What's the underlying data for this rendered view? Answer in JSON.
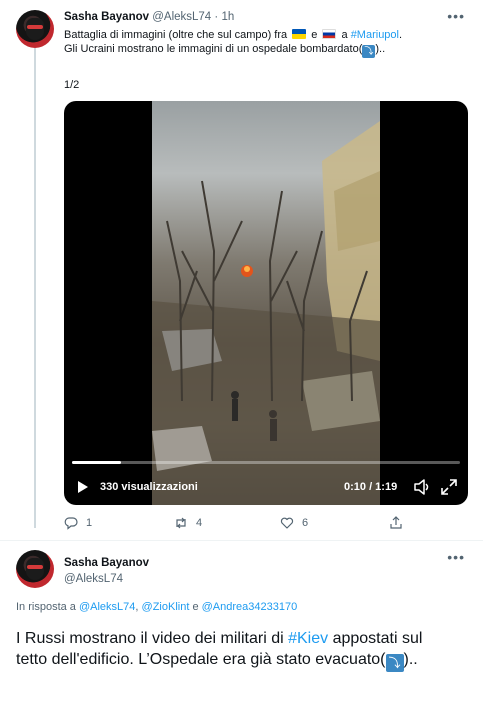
{
  "tweet1": {
    "author_name": "Sasha Bayanov",
    "author_handle": "@AleksL74",
    "separator": "·",
    "time": "1h",
    "more_icon": "more-horizontal-icon",
    "line1_prefix": "Battaglia di immagini (oltre che sul campo) fra ",
    "line1_and": " e ",
    "line1_a": " a ",
    "hashtag": "#Mariupol",
    "line1_end": ".",
    "line2": "Gli Ucraini mostrano le immagini di un ospedale bombardato(",
    "line2_end": ")..",
    "counter": "1/2",
    "video": {
      "views": "330 visualizzazioni",
      "time": "0:10 / 1:19",
      "progress": 0.127
    },
    "actions": {
      "reply_count": "1",
      "retweet_count": "4",
      "like_count": "6"
    }
  },
  "tweet2": {
    "author_name": "Sasha Bayanov",
    "author_handle": "@AleksL74",
    "reply_prefix": "In risposta a ",
    "reply_user1": "@AleksL74",
    "reply_sep1": ", ",
    "reply_user2": "@ZioKlint",
    "reply_sep2": " e ",
    "reply_user3": "@Andrea34233170",
    "text_prefix": "I Russi mostrano il video dei militari di ",
    "hashtag": "#Kiev",
    "text_mid": " appostati sul tetto dell'edificio. L’Ospedale era già stato evacuato(",
    "text_end": ").."
  },
  "colors": {
    "link": "#1d9bf0",
    "muted": "#536471",
    "text": "#0f1419"
  }
}
